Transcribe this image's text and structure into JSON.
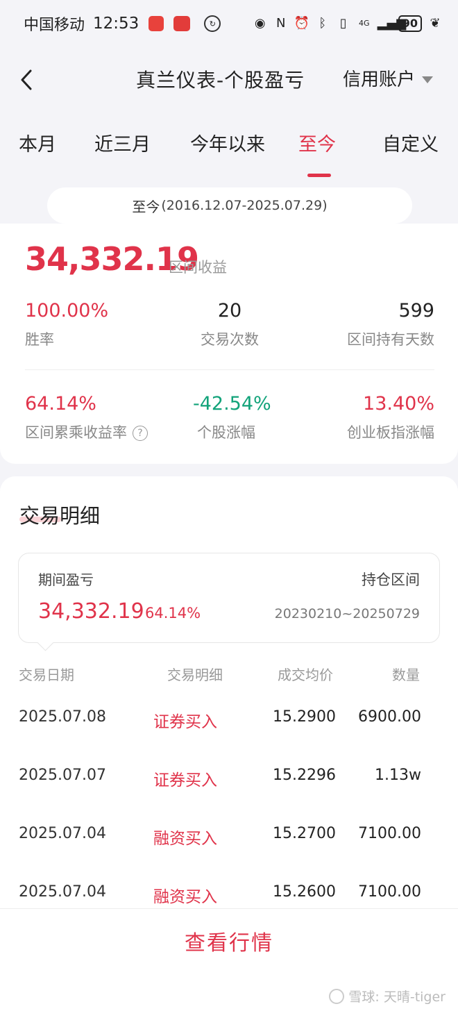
{
  "status_bar": {
    "carrier": "中国移动",
    "time": "12:53",
    "battery": "90",
    "network": "4G"
  },
  "nav": {
    "title": "真兰仪表-个股盈亏",
    "account": "信用账户"
  },
  "tabs": [
    {
      "label": "本月",
      "active": false
    },
    {
      "label": "近三月",
      "active": false
    },
    {
      "label": "今年以来",
      "active": false
    },
    {
      "label": "至今",
      "active": true
    },
    {
      "label": "自定义",
      "active": false
    }
  ],
  "range": {
    "label": "至今",
    "dates": "(2016.12.07-2025.07.29)"
  },
  "summary": {
    "profit": "34,332.19",
    "profit_label": "区间收益",
    "win_rate": "100.00%",
    "win_rate_label": "胜率",
    "trade_count": "20",
    "trade_count_label": "交易次数",
    "hold_days": "599",
    "hold_days_label": "区间持有天数",
    "cum_return": "64.14%",
    "cum_return_label": "区间累乘收益率",
    "stock_change": "-42.54%",
    "stock_change_label": "个股涨幅",
    "index_change": "13.40%",
    "index_change_label": "创业板指涨幅"
  },
  "details": {
    "title": "交易明细",
    "period_label": "期间盈亏",
    "period_value": "34,332.19",
    "period_rate": "64.14%",
    "hold_label": "持仓区间",
    "hold_range": "20230210~20250729",
    "columns": [
      "交易日期",
      "交易明细",
      "成交均价",
      "数量"
    ],
    "rows": [
      {
        "date": "2025.07.08",
        "type": "证券买入",
        "price": "15.2900",
        "qty": "6900.00"
      },
      {
        "date": "2025.07.07",
        "type": "证券买入",
        "price": "15.2296",
        "qty": "1.13w"
      },
      {
        "date": "2025.07.04",
        "type": "融资买入",
        "price": "15.2700",
        "qty": "7100.00"
      },
      {
        "date": "2025.07.04",
        "type": "融资买入",
        "price": "15.2600",
        "qty": "7100.00"
      }
    ]
  },
  "bottom": {
    "view_market": "查看行情",
    "watermark": "雪球: 天晴-tiger"
  }
}
